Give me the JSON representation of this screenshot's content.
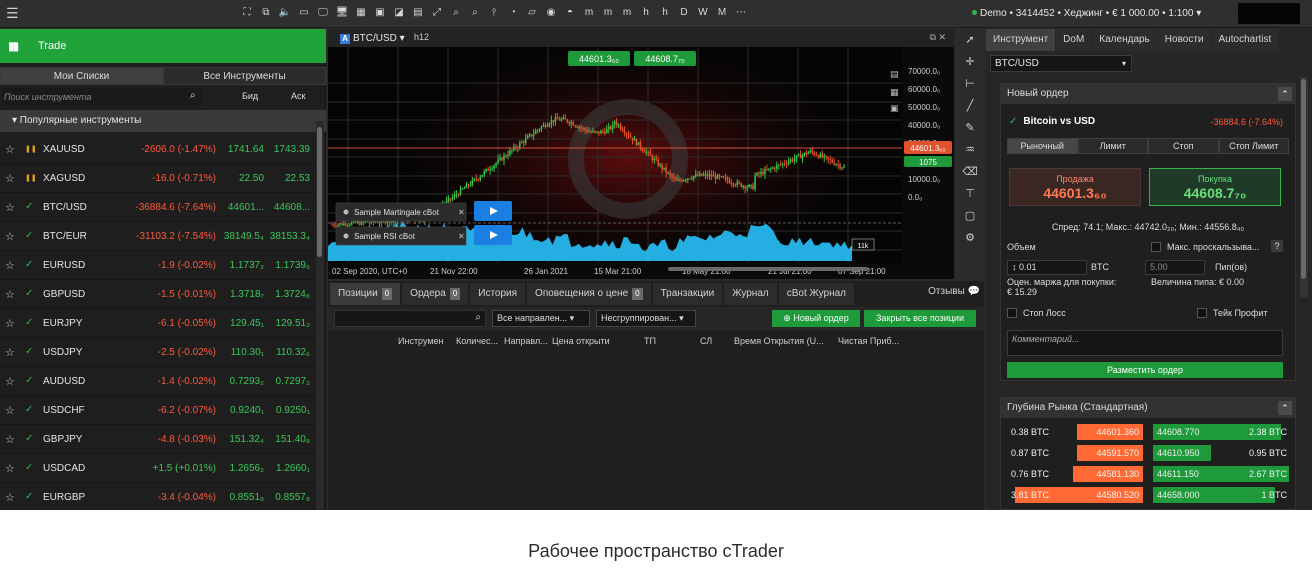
{
  "toolbar": {
    "icons": [
      "⛶",
      "⧉",
      "🔈",
      "▭",
      "🖵",
      "🖥",
      "▦",
      "▣",
      "◪",
      "▤",
      "⤢",
      "⌕",
      "⌕",
      "⫯",
      "◔",
      "▱",
      "◉",
      "◓",
      "m",
      "m",
      "m",
      "h",
      "h",
      "D",
      "W",
      "M",
      "⋯"
    ],
    "account_text": "Demo • 3414452 • Хеджинг • € 1 000.00 • 1:100"
  },
  "left": {
    "trade_label": "Trade",
    "tab_my_lists": "Мои Списки",
    "tab_all": "Все Инструменты",
    "search_placeholder": "Поиск инструмента",
    "col_bid": "Бид",
    "col_ask": "Аск",
    "group_title": "▾ Популярные инструменты",
    "instruments": [
      {
        "symbol": "XAUUSD",
        "change": "-2606.0 (-1.47%)",
        "bid": "1741.64",
        "ask": "1743.39",
        "dir": "neg",
        "mark": "pause"
      },
      {
        "symbol": "XAGUSD",
        "change": "-16.0 (-0.71%)",
        "bid": "22.50",
        "ask": "22.53",
        "dir": "neg",
        "mark": "pause"
      },
      {
        "symbol": "BTC/USD",
        "change": "-36884.6 (-7.64%)",
        "bid": "44601...",
        "ask": "44608...",
        "dir": "neg",
        "mark": "check"
      },
      {
        "symbol": "BTC/EUR",
        "change": "-31103.2 (-7.54%)",
        "bid": "38149.5₄",
        "ask": "38153.3₄",
        "dir": "neg",
        "mark": "check"
      },
      {
        "symbol": "EURUSD",
        "change": "-1.9 (-0.02%)",
        "bid": "1.1737₂",
        "ask": "1.1739₆",
        "dir": "neg",
        "mark": "check"
      },
      {
        "symbol": "GBPUSD",
        "change": "-1.5 (-0.01%)",
        "bid": "1.3718₇",
        "ask": "1.3724₈",
        "dir": "neg",
        "mark": "check"
      },
      {
        "symbol": "EURJPY",
        "change": "-6.1 (-0.05%)",
        "bid": "129.45₁",
        "ask": "129.51₂",
        "dir": "neg",
        "mark": "check"
      },
      {
        "symbol": "USDJPY",
        "change": "-2.5 (-0.02%)",
        "bid": "110.30₁",
        "ask": "110.32₆",
        "dir": "neg",
        "mark": "check"
      },
      {
        "symbol": "AUDUSD",
        "change": "-1.4 (-0.02%)",
        "bid": "0.7293₂",
        "ask": "0.7297₂",
        "dir": "neg",
        "mark": "check"
      },
      {
        "symbol": "USDCHF",
        "change": "-6.2 (-0.07%)",
        "bid": "0.9240₁",
        "ask": "0.9250₁",
        "dir": "neg",
        "mark": "check"
      },
      {
        "symbol": "GBPJPY",
        "change": "-4.8 (-0.03%)",
        "bid": "151.32₄",
        "ask": "151.40₈",
        "dir": "neg",
        "mark": "check"
      },
      {
        "symbol": "USDCAD",
        "change": "+1.5 (+0.01%)",
        "bid": "1.2656₂",
        "ask": "1.2660₁",
        "dir": "pos",
        "mark": "check"
      },
      {
        "symbol": "EURGBP",
        "change": "-3.4 (-0.04%)",
        "bid": "0.8551₉",
        "ask": "0.8557₈",
        "dir": "neg",
        "mark": "check"
      }
    ]
  },
  "chart": {
    "symbol": "BTC/USD",
    "timeframe": "h12",
    "bid_tag": "44601.3₆₀",
    "ask_tag": "44608.7₇₀",
    "price_tag": "44601.3₆₀",
    "green_tag": "1075",
    "y_ticks": [
      "70000.0₀",
      "60000.0₀",
      "50000.0₀",
      "40000.0₀",
      "30000.0₀",
      "20000.0₀",
      "10000.0₀",
      "0.0₀"
    ],
    "x_ticks": [
      "02 Sep 2020, UTC+0",
      "21 Nov 22:00",
      "26 Jan 2021",
      "15 Mar 21:00",
      "18 May 21:00",
      "21 Jul 21:00",
      "07 Sep 21:00"
    ],
    "last_vol": "11k",
    "bots": [
      {
        "name": "Sample Martingale cBot"
      },
      {
        "name": "Sample RSI cBot"
      }
    ]
  },
  "bottom": {
    "tabs": [
      {
        "label": "Позиции",
        "count": "0"
      },
      {
        "label": "Ордера",
        "count": "0"
      },
      {
        "label": "История",
        "count": ""
      },
      {
        "label": "Оповещения о цене",
        "count": "0"
      },
      {
        "label": "Транзакции",
        "count": ""
      },
      {
        "label": "Журнал",
        "count": ""
      },
      {
        "label": "cBot Журнал",
        "count": ""
      }
    ],
    "reviews": "Отзывы",
    "dir_select": "Все направлен...",
    "group_select": "Несгруппирован...",
    "new_order": "Новый ордер",
    "close_all": "Закрыть все позиции",
    "columns": [
      "Инструмен",
      "Количес...",
      "Направл...",
      "Цена открыти",
      "ТП",
      "СЛ",
      "Время Открытия (U...",
      "Чистая Приб..."
    ]
  },
  "right": {
    "tabs": [
      "Инструмент",
      "DoM",
      "Календарь",
      "Новости",
      "Autochartist"
    ],
    "symbol": "BTC/USD",
    "order_title": "Новый ордер",
    "instrument_name": "Bitcoin vs USD",
    "instrument_change": "-36884.6 (-7.64%)",
    "order_types": [
      "Рыночный",
      "Лимит",
      "Стоп",
      "Стоп Лимит"
    ],
    "sell_label": "Продажа",
    "sell_price": "44601.3₆₀",
    "buy_label": "Покупка",
    "buy_price": "44608.7₇₀",
    "spread_text": "Спред: 74.1; Макс.: 44742.0₂₀; Мин.: 44556.8₄₀",
    "volume_label": "Объем",
    "volume_value": "0.01",
    "volume_unit": "BTC",
    "max_slip": "Макс. проскальзыва...",
    "slip_value": "5.00",
    "slip_unit": "Пип(ов)",
    "margin_est": "Оцен. маржа для покупки:",
    "margin_value": "€ 15.29",
    "pip_value": "Величина пипа: € 0.00",
    "stop_loss": "Стоп Лосс",
    "take_profit": "Тейк Профит",
    "comment_placeholder": "Комментарий...",
    "place_order": "Разместить ордер",
    "depth_title": "Глубина Рынка (Стандартная)",
    "depth_rows": [
      {
        "l_vol": "0.38 BTC",
        "l_px": "44601.360",
        "r_px": "44608.770",
        "r_vol": "2.38 BTC"
      },
      {
        "l_vol": "0.87 BTC",
        "l_px": "44591.570",
        "r_px": "44610.950",
        "r_vol": "0.95 BTC"
      },
      {
        "l_vol": "0.76 BTC",
        "l_px": "44581.130",
        "r_px": "44611.150",
        "r_vol": "2.67 BTC"
      },
      {
        "l_vol": "3.81 BTC",
        "l_px": "44580.520",
        "r_px": "44658.000",
        "r_vol": "1 BTC"
      }
    ]
  },
  "caption": "Рабочее пространство cTrader",
  "colors": {
    "green": "#1fa33a",
    "red": "#ff5a3c",
    "volume": "#27b7ee"
  }
}
